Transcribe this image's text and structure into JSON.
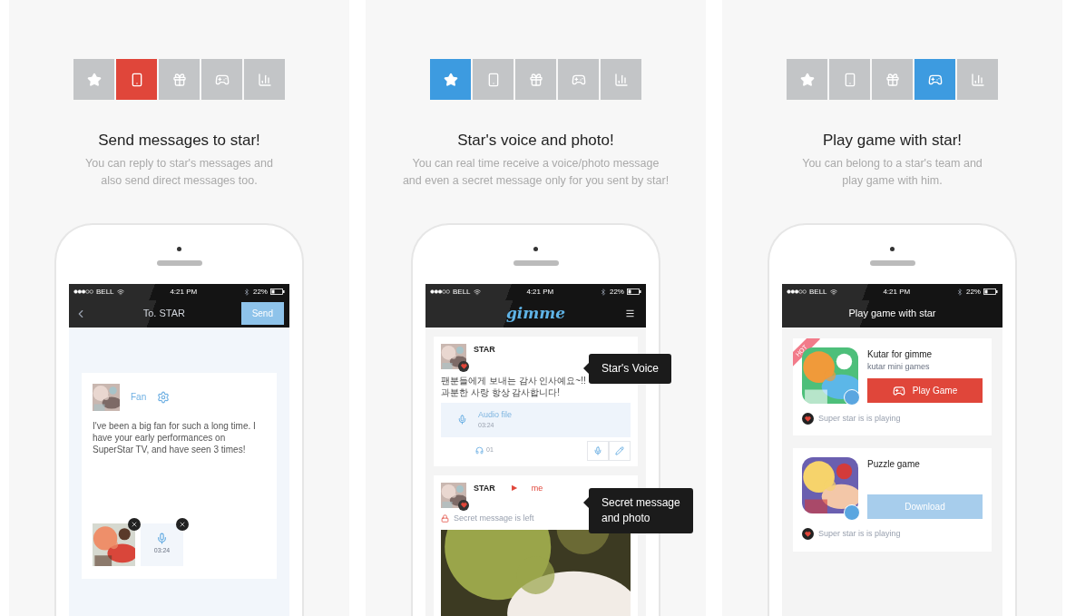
{
  "panels": [
    {
      "kind": "compose",
      "color": "#e0463a",
      "tabs": [
        {
          "selected": false
        },
        {
          "selected": true
        },
        {
          "selected": false
        },
        {
          "selected": false
        },
        {
          "selected": false
        }
      ],
      "title": "Send messages to star!",
      "description": [
        "You can reply to star's messages and",
        "also send direct messages too."
      ],
      "screen": {
        "status": {
          "carrier": "BELL",
          "time": "4:21 PM",
          "battery": "22%"
        },
        "nav_title": "To. STAR",
        "send": "Send",
        "card": {
          "author": "Fan",
          "message": "I've been a big fan for such a long time. I have your early performances on SuperStar TV, and have seen 3 times!",
          "audio_duration": "03:24"
        }
      }
    },
    {
      "kind": "feed",
      "color": "#3d9be0",
      "tabs": [
        {
          "selected": true
        },
        {
          "selected": false
        },
        {
          "selected": false
        },
        {
          "selected": false
        },
        {
          "selected": false
        }
      ],
      "title": "Star's voice and photo!",
      "description": [
        "You can real time receive a voice/photo message",
        "and even a secret message only for you sent by star!"
      ],
      "screen": {
        "status": {
          "carrier": "BELL",
          "time": "4:21 PM",
          "battery": "22%"
        },
        "logo": "gimme",
        "posts": [
          {
            "author": "STAR",
            "text": [
              "팬분들에게 보내는 감사 인사예요~!!",
              "과분한 사랑 항상 감사합니다!"
            ],
            "audio_label": "Audio file",
            "audio_duration": "03:24",
            "count": "01"
          },
          {
            "author": "STAR",
            "arrow": "▶",
            "recipient": "me",
            "secret": "Secret message is left"
          }
        ]
      },
      "callouts": [
        [
          "Star's Voice"
        ],
        [
          "Secret message",
          "and photo"
        ]
      ]
    },
    {
      "kind": "games",
      "color": "#3d9be0",
      "tabs": [
        {
          "selected": false
        },
        {
          "selected": false
        },
        {
          "selected": false
        },
        {
          "selected": true
        },
        {
          "selected": false
        }
      ],
      "title": "Play game with star!",
      "description": [
        "You can belong to a star's team and",
        "play game with him."
      ],
      "screen": {
        "status": {
          "carrier": "BELL",
          "time": "4:21 PM",
          "battery": "22%"
        },
        "nav_title": "Play game with star",
        "games": [
          {
            "title": "Kutar for gimme",
            "subtitle": "kutar mini games",
            "hot": "HOT",
            "action": {
              "kind": "play",
              "label": "Play Game"
            },
            "status": "Super star is is playing"
          },
          {
            "title": "Puzzle game",
            "action": {
              "kind": "download",
              "label": "Download"
            },
            "status": "Super star is is playing"
          }
        ]
      }
    }
  ]
}
